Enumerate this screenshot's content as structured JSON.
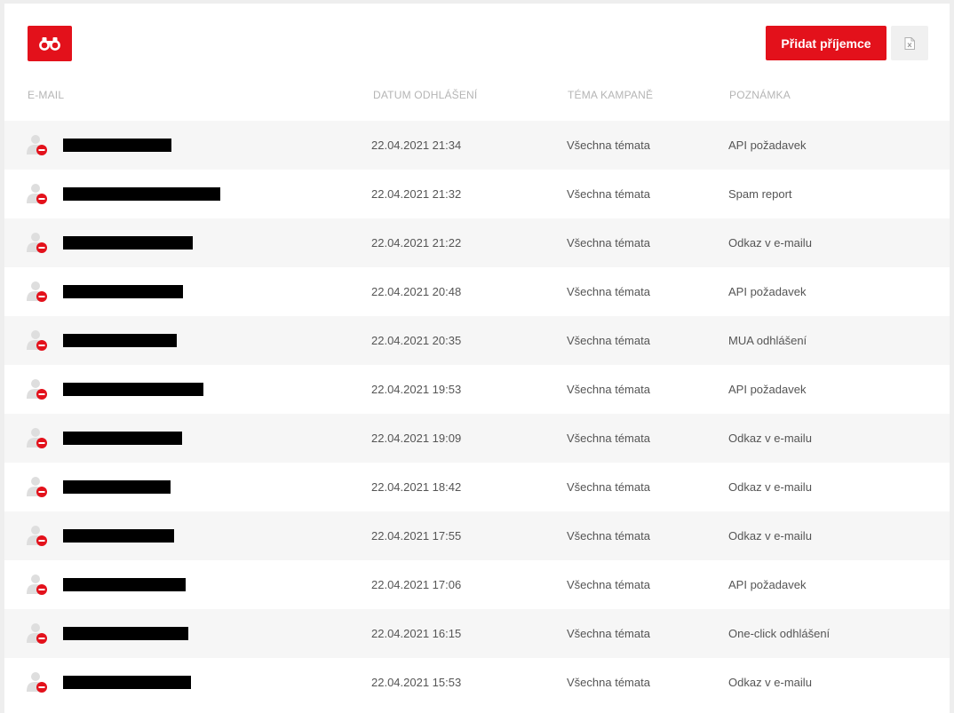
{
  "toolbar": {
    "search_icon": "binoculars-icon",
    "add_recipient_label": "Přidat příjemce",
    "export_icon": "excel-file-icon"
  },
  "colors": {
    "accent": "#e3111b",
    "row_alt": "#f6f6f6",
    "header_text": "#b5b5b5",
    "cell_text": "#555555"
  },
  "table": {
    "columns": [
      "E-MAIL",
      "DATUM ODHLÁŠENÍ",
      "TÉMA KAMPANĚ",
      "POZNÁMKA"
    ],
    "rows": [
      {
        "date": "22.04.2021 21:34",
        "topic": "Všechna témata",
        "note": "API požadavek"
      },
      {
        "date": "22.04.2021 21:32",
        "topic": "Všechna témata",
        "note": "Spam report"
      },
      {
        "date": "22.04.2021 21:22",
        "topic": "Všechna témata",
        "note": "Odkaz v e-mailu"
      },
      {
        "date": "22.04.2021 20:48",
        "topic": "Všechna témata",
        "note": "API požadavek"
      },
      {
        "date": "22.04.2021 20:35",
        "topic": "Všechna témata",
        "note": "MUA odhlášení"
      },
      {
        "date": "22.04.2021 19:53",
        "topic": "Všechna témata",
        "note": "API požadavek"
      },
      {
        "date": "22.04.2021 19:09",
        "topic": "Všechna témata",
        "note": "Odkaz v e-mailu"
      },
      {
        "date": "22.04.2021 18:42",
        "topic": "Všechna témata",
        "note": "Odkaz v e-mailu"
      },
      {
        "date": "22.04.2021 17:55",
        "topic": "Všechna témata",
        "note": "Odkaz v e-mailu"
      },
      {
        "date": "22.04.2021 17:06",
        "topic": "Všechna témata",
        "note": "API požadavek"
      },
      {
        "date": "22.04.2021 16:15",
        "topic": "Všechna témata",
        "note": "One-click odhlášení"
      },
      {
        "date": "22.04.2021 15:53",
        "topic": "Všechna témata",
        "note": "Odkaz v e-mailu"
      }
    ]
  }
}
